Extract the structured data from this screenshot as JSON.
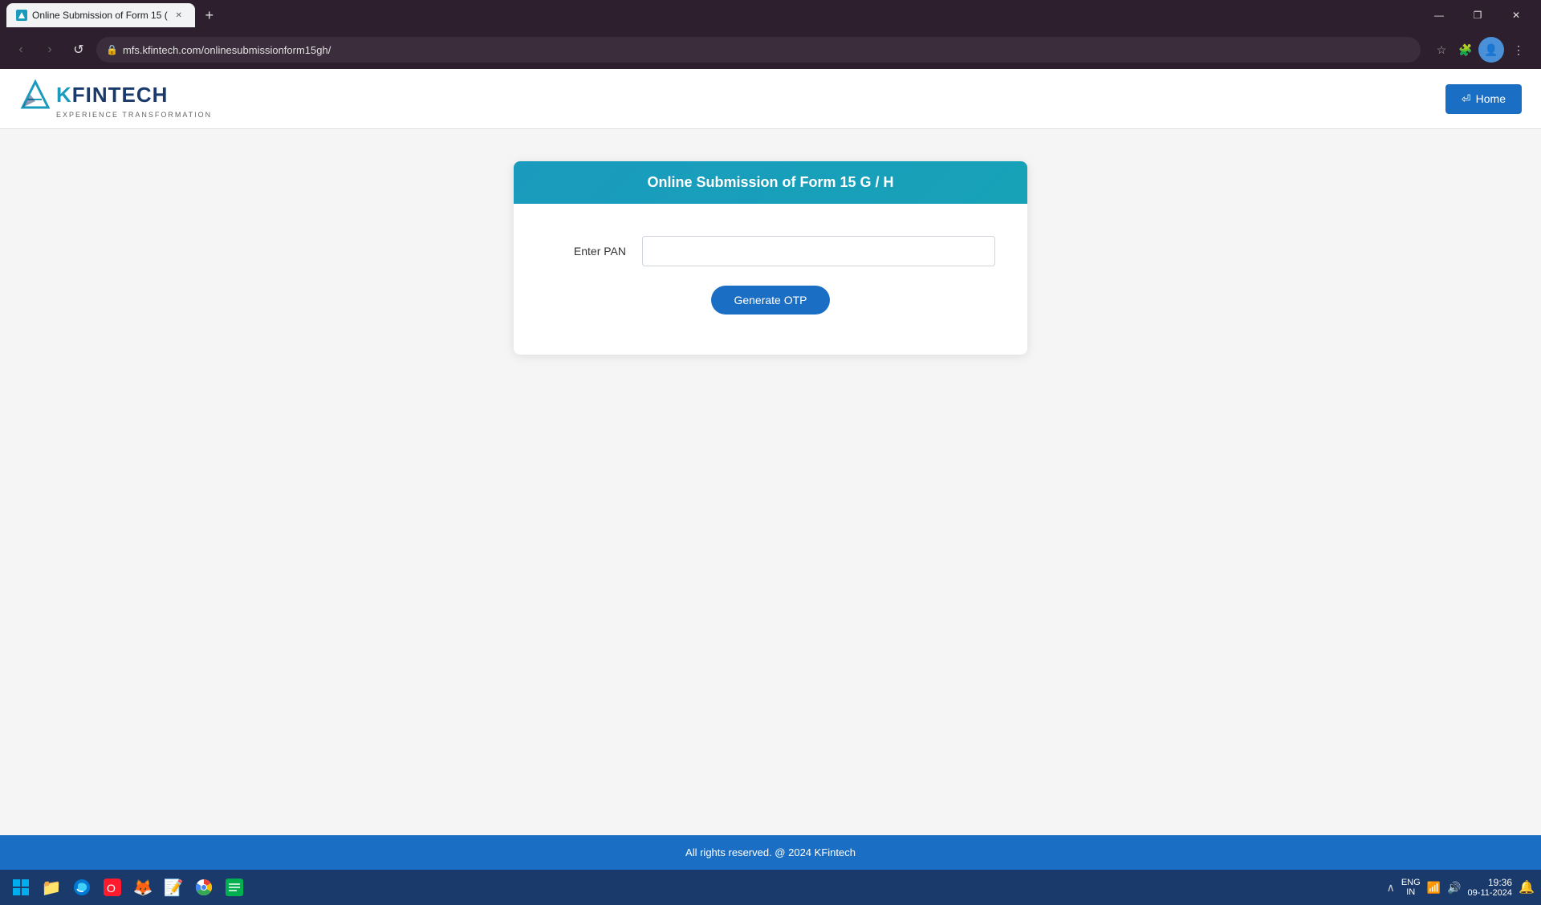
{
  "browser": {
    "tab": {
      "title": "Online Submission of Form 15 (",
      "favicon_color": "#1a9bbd"
    },
    "url": "mfs.kfintech.com/onlinesubmissionform15gh/",
    "window_controls": {
      "minimize": "—",
      "maximize": "❐",
      "close": "✕"
    },
    "nav": {
      "back": "‹",
      "forward": "›",
      "refresh": "↺"
    },
    "toolbar": {
      "bookmark": "☆",
      "extensions": "🧩",
      "profile": "👤",
      "menu": "⋮"
    }
  },
  "header": {
    "logo": {
      "brand_k": "K",
      "brand_rest": "FINTECH",
      "tagline": "EXPERIENCE TRANSFORMATION"
    },
    "home_button": "⏎ Home"
  },
  "form": {
    "title": "Online Submission of Form 15 G / H",
    "pan_label": "Enter PAN",
    "pan_placeholder": "",
    "generate_otp_button": "Generate OTP"
  },
  "footer": {
    "text": "All rights reserved. @ 2024 KFintech"
  },
  "taskbar": {
    "icons": [
      {
        "name": "windows-start",
        "symbol": "⊞"
      },
      {
        "name": "file-explorer",
        "symbol": "📁"
      },
      {
        "name": "browser1",
        "symbol": "🔵"
      },
      {
        "name": "browser2",
        "symbol": "🟡"
      },
      {
        "name": "firefox",
        "symbol": "🦊"
      },
      {
        "name": "notepad",
        "symbol": "📝"
      },
      {
        "name": "chrome",
        "symbol": "🔴"
      },
      {
        "name": "app7",
        "symbol": "🟩"
      }
    ],
    "sys": {
      "lang": "ENG\nIN",
      "wifi": "📶",
      "sound": "🔊",
      "time": "19:36",
      "date": "09-11-2024",
      "notification": "🔔"
    }
  }
}
